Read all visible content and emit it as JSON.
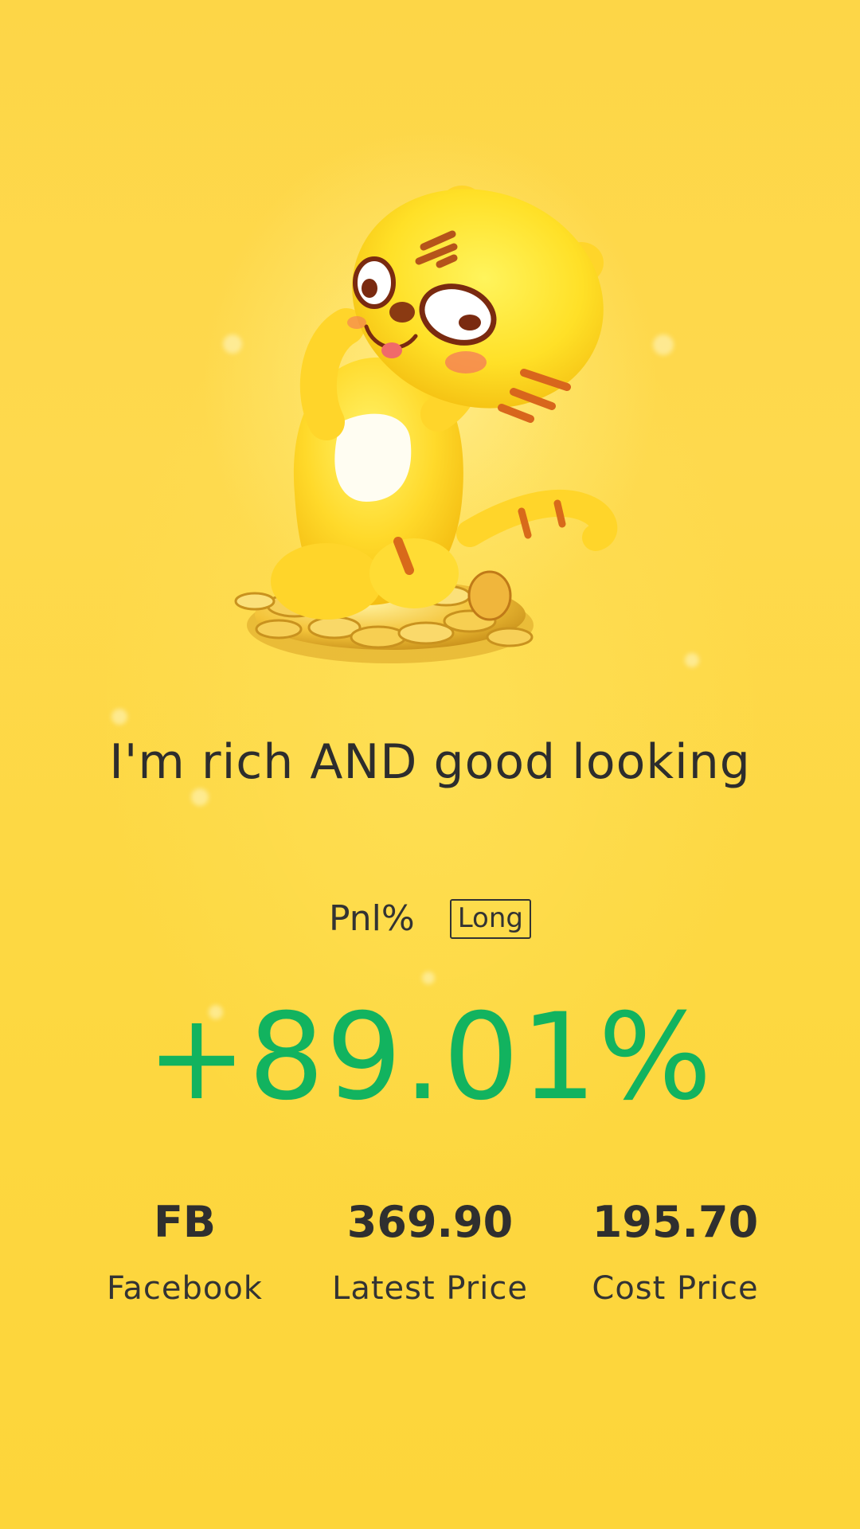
{
  "slogan": "I'm rich AND good looking",
  "pnl": {
    "label": "Pnl%",
    "side": "Long",
    "value": "+89.01%",
    "value_color": "#12b35f"
  },
  "stats": [
    {
      "value": "FB",
      "label": "Facebook"
    },
    {
      "value": "369.90",
      "label": "Latest Price"
    },
    {
      "value": "195.70",
      "label": "Cost Price"
    }
  ],
  "mascot": {
    "icon": "tiger-mascot-on-coins-illustration"
  },
  "colors": {
    "background": "#fdd647",
    "text": "#2d2d2d",
    "gain": "#12b35f"
  }
}
